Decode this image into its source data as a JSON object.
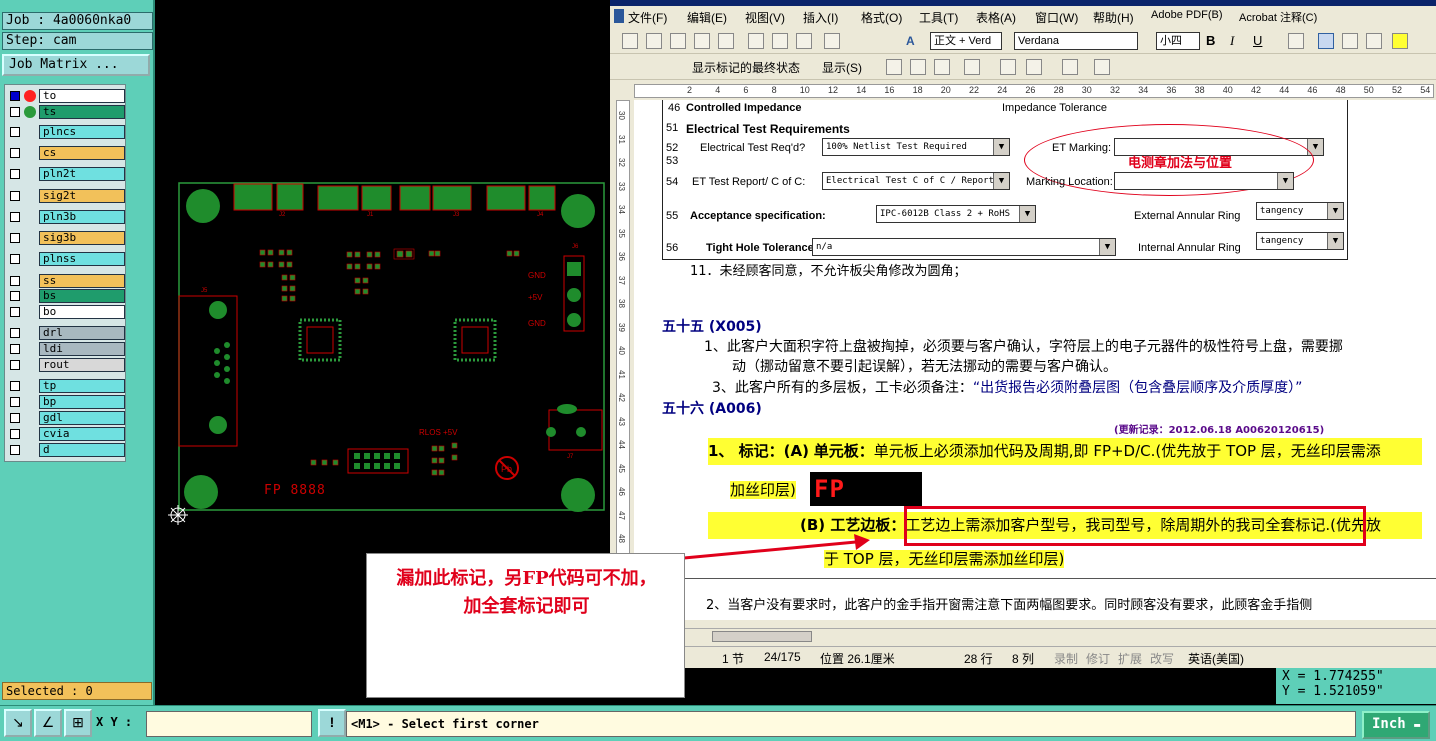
{
  "app": {
    "job": "Job : 4a0060nka0",
    "step": "Step: cam",
    "job_matrix": "Job Matrix ...",
    "selected": "Selected : 0"
  },
  "layers": [
    {
      "name": "to",
      "color": "#ffffff",
      "dot": "#ff2222",
      "active": true
    },
    {
      "name": "ts",
      "color": "#1f9c6c",
      "dot": "#2b9a3c"
    },
    {
      "name": "plncs",
      "color": "#6fe0e0"
    },
    {
      "name": "cs",
      "color": "#f2c15a"
    },
    {
      "name": "pln2t",
      "color": "#6fe0e0"
    },
    {
      "name": "sig2t",
      "color": "#f2c15a"
    },
    {
      "name": "pln3b",
      "color": "#6fe0e0"
    },
    {
      "name": "sig3b",
      "color": "#f2c15a"
    },
    {
      "name": "plnss",
      "color": "#6fe0e0"
    },
    {
      "name": "ss",
      "color": "#f2c15a"
    },
    {
      "name": "bs",
      "color": "#1f9c6c"
    },
    {
      "name": "bo",
      "color": "#ffffff"
    },
    {
      "name": "drl",
      "color": "#a8b8c0"
    },
    {
      "name": "ldi",
      "color": "#a8b8c0"
    },
    {
      "name": "rout",
      "color": "#d8d8d8"
    },
    {
      "name": "tp",
      "color": "#6fe0e0"
    },
    {
      "name": "bp",
      "color": "#6fe0e0"
    },
    {
      "name": "gdl",
      "color": "#6fe0e0"
    },
    {
      "name": "cvia",
      "color": "#6fe0e0"
    },
    {
      "name": "d",
      "color": "#6fe0e0"
    }
  ],
  "board": {
    "labels": [
      "GND",
      "+5V",
      "GND",
      "RLOS +5V",
      "FP 8888"
    ],
    "refdes": [
      "J2",
      "J1",
      "J3",
      "J4",
      "J6",
      "J5",
      "J7",
      "U1"
    ]
  },
  "word": {
    "menu": [
      "文件(F)",
      "编辑(E)",
      "视图(V)",
      "插入(I)",
      "格式(O)",
      "工具(T)",
      "表格(A)",
      "窗口(W)",
      "帮助(H)",
      "Adobe PDF(B)",
      "Acrobat 注释(C)"
    ],
    "toolbar": {
      "style": "正文 + Verd",
      "font": "Verdana",
      "size": "小四",
      "markup_view": "显示标记的最终状态",
      "show": "显示(S)",
      "bold": "B",
      "italic": "I",
      "underline": "U"
    },
    "ruler_marks": [
      "2",
      "4",
      "6",
      "8",
      "10",
      "12",
      "14",
      "16",
      "18",
      "20",
      "22",
      "24",
      "26",
      "28",
      "30",
      "32",
      "34",
      "36",
      "38",
      "40",
      "42",
      "44",
      "46",
      "48",
      "50",
      "52",
      "54"
    ],
    "vruler_marks": [
      "30",
      "31",
      "32",
      "33",
      "34",
      "35",
      "36",
      "37",
      "38",
      "39",
      "40",
      "41",
      "42",
      "43",
      "44",
      "45",
      "46",
      "47",
      "48",
      "49",
      "50"
    ],
    "table": {
      "row46_num": "46",
      "row46_label": "Controlled Impedance",
      "row46_right": "Impedance Tolerance",
      "row51_num": "51",
      "row51_label": "Electrical Test Requirements",
      "row52_num": "52",
      "row53_num": "53",
      "row52_label": "Electrical Test Req'd?",
      "row52_value": "100% Netlist Test Required",
      "et_marking_label": "ET Marking:",
      "et_annotation": "电测章加法与位置",
      "row54_num": "54",
      "row54_label": "ET Test Report/ C of C:",
      "row54_value": "Electrical Test C of C / Report",
      "marking_location_label": "Marking Location:",
      "row55_num": "55",
      "row55_label": "Acceptance specification:",
      "row55_value": "IPC-6012B Class 2 + RoHS",
      "ext_ring_label": "External Annular Ring",
      "ext_ring_value": "tangency",
      "row56_num": "56",
      "row56_label": "Tight Hole Tolerance:",
      "row56_value": "n/a",
      "int_ring_label": "Internal Annular Ring",
      "int_ring_value": "tangency"
    },
    "body": {
      "p11": "11．未经顾客同意，不允许板尖角修改为圆角；",
      "h55": "五十五   (X005)",
      "p55_1a": "1、此客户大面积字符上盘被掏掉，必须要与客户确认，字符层上的电子元器件的极性符号上盘，需要挪",
      "p55_1b": "动（挪动留意不要引起误解），若无法挪动的需要与客户确认。",
      "p55_3a": "3、此客户所有的多层板，工卡必须备注：",
      "p55_3b": "“出货报告必须附叠层图（包含叠层顺序及介质厚度）”",
      "h56": "五十六   (A006)",
      "update_note": "(更新记录：2012.06.18    A00620120615)",
      "p56_1_prefix": "1、   标记：(A)",
      "p56_1_single": "单元板：",
      "p56_1_text": "单元板上必须添加代码及周期,即 FP+D/C.(优先放于 TOP 层，无丝印层需添",
      "p56_1_text2": "加丝印层)",
      "fp_sample": "FP 8888",
      "p56_b_prefix": "(B) 工艺边板：",
      "p56_b_text": "工艺边上需添加客户型号，我司型号，除周期外的我司全套标记.",
      "p56_b_tail": "(优先放",
      "p56_b_line2": "于 TOP 层，无丝印层需添加丝印层)",
      "p2": "2、当客户没有要求时，此客户的金手指开窗需注意下面两幅图要求。同时顾客没有要求，此顾客金手指侧"
    },
    "status": {
      "page": "1 节",
      "pages": "24/175",
      "position": "位置 26.1厘米",
      "line": "28 行",
      "col": "8 列",
      "rec": "录制",
      "trk": "修订",
      "ext": "扩展",
      "ovr": "改写",
      "lang": "英语(美国)"
    }
  },
  "callout": {
    "line1": "漏加此标记，另FP代码可不加，",
    "line2": "加全套标记即可"
  },
  "coords": {
    "x": "X = 1.774255\"",
    "y": "Y = 1.521059\""
  },
  "bottombar": {
    "xy_label": "X Y :",
    "xy_value": "",
    "message": "<M1> - Select first corner",
    "units": "Inch"
  },
  "colors": {
    "panel": "#5ecfb8",
    "board_outline": "#2b9a3c",
    "silk_red": "#e0001b",
    "highlight": "#ffff33"
  }
}
